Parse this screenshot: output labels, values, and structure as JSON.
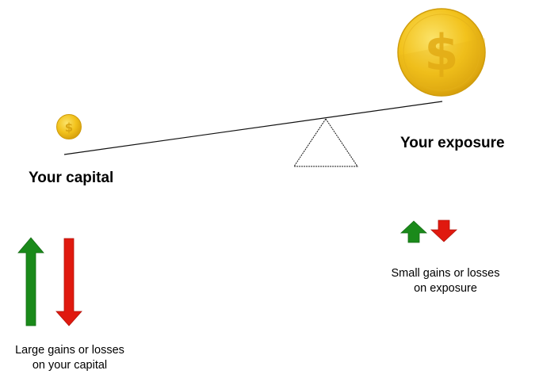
{
  "labels": {
    "capital": "Your capital",
    "exposure": "Your exposure"
  },
  "captions": {
    "capital_line1": "Large gains or losses",
    "capital_line2": "on your capital",
    "exposure_line1": "Small gains or losses",
    "exposure_line2": "on exposure"
  },
  "icons": {
    "small_coin": "dollar-coin-icon",
    "large_coin": "dollar-coin-icon",
    "up_arrow": "arrow-up-icon",
    "down_arrow": "arrow-down-icon",
    "fulcrum": "triangle-fulcrum-icon"
  },
  "colors": {
    "gain": "#1a8a1a",
    "loss": "#e0190f",
    "coin_gold": "#f2c21c",
    "coin_dark": "#d4a010"
  }
}
